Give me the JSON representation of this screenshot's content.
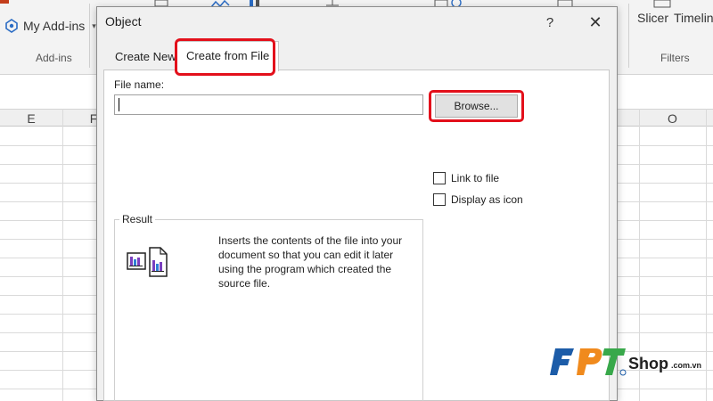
{
  "ribbon": {
    "my_addins": "My Add-ins",
    "addins_group": "Add-ins",
    "slicer": "Slicer",
    "timeline": "Timelin",
    "filters_group": "Filters"
  },
  "sheet": {
    "columns": [
      "E",
      "F",
      "O"
    ]
  },
  "dialog": {
    "title": "Object",
    "help": "?",
    "close": "✕",
    "tabs": [
      {
        "label": "Create New",
        "selected": false
      },
      {
        "label": "Create from File",
        "selected": true
      }
    ],
    "file_name_label": "File name:",
    "file_name_value": "",
    "browse_label": "Browse...",
    "link_to_file": {
      "label": "Link to file",
      "checked": false
    },
    "display_as_icon": {
      "label": "Display as icon",
      "checked": false
    },
    "result_label": "Result",
    "result_text": "Inserts the contents of the file into your document so that you can edit it later using the program which created the source file."
  },
  "watermark": {
    "brand": "FPT",
    "shop": "Shop",
    "domain": ".com.vn",
    "colors": {
      "blue": "#1c5ca8",
      "orange": "#f08a1d",
      "green": "#38a84a"
    }
  },
  "highlight_color": "#e3101b"
}
